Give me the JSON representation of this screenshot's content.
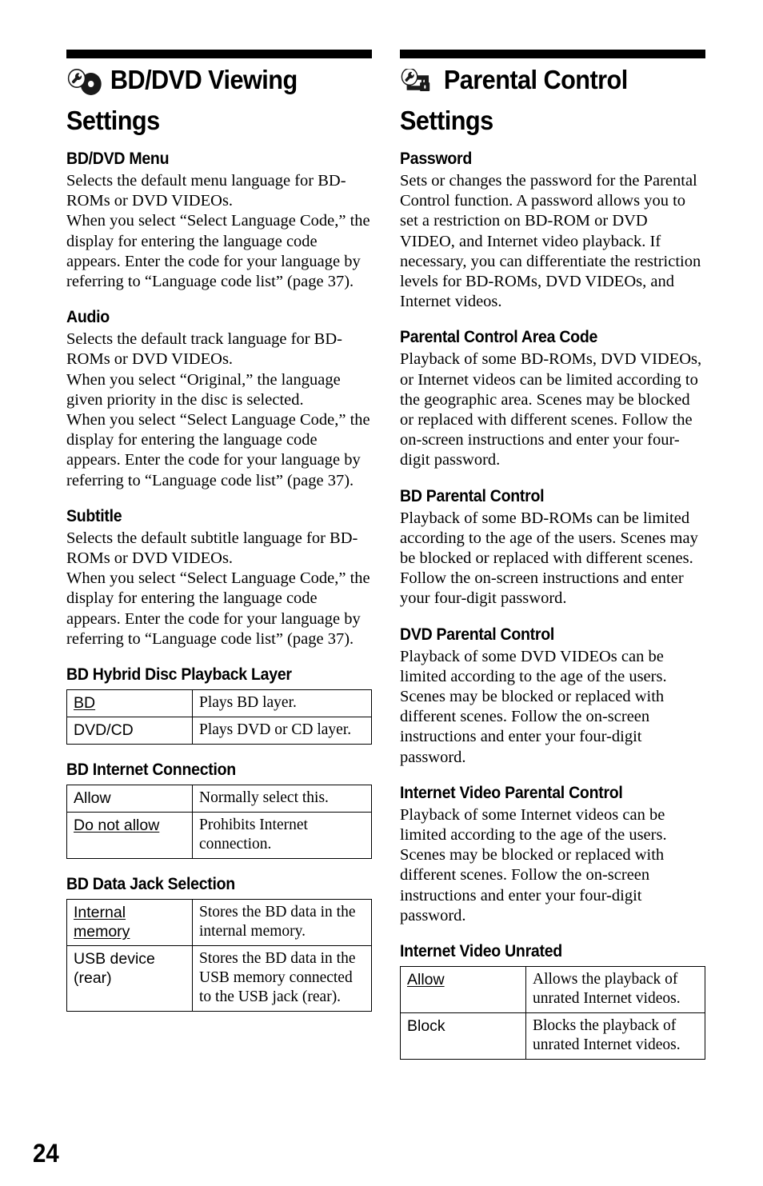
{
  "page": {
    "number": "24"
  },
  "left_column": {
    "title": "BD/DVD Viewing Settings",
    "icon": "wrench-disc-icon",
    "sections": [
      {
        "heading": "BD/DVD Menu",
        "body": "Selects the default menu language for BD-ROMs or DVD VIDEOs.\nWhen you select “Select Language Code,” the display for entering the language code appears. Enter the code for your language by referring to “Language code list” (page 37)."
      },
      {
        "heading": "Audio",
        "body": "Selects the default track language for BD-ROMs or DVD VIDEOs.\nWhen you select “Original,” the language given priority in the disc is selected.\nWhen you select “Select Language Code,” the display for entering the language code appears. Enter the code for your language by referring to “Language code list” (page 37)."
      },
      {
        "heading": "Subtitle",
        "body": "Selects the default subtitle language for BD-ROMs or DVD VIDEOs.\nWhen you select “Select Language Code,” the display for entering the language code appears. Enter the code for your language by referring to “Language code list” (page 37)."
      }
    ],
    "tables": [
      {
        "heading": "BD Hybrid Disc Playback Layer",
        "rows": [
          {
            "option": "BD",
            "default": true,
            "description": "Plays BD layer."
          },
          {
            "option": "DVD/CD",
            "default": false,
            "description": "Plays DVD or CD layer."
          }
        ]
      },
      {
        "heading": "BD Internet Connection",
        "rows": [
          {
            "option": "Allow",
            "default": false,
            "description": "Normally select this."
          },
          {
            "option": "Do not allow",
            "default": true,
            "description": "Prohibits Internet connection."
          }
        ]
      },
      {
        "heading": "BD Data Jack Selection",
        "rows": [
          {
            "option": "Internal memory",
            "default": true,
            "description": "Stores the BD data in the internal memory."
          },
          {
            "option": "USB device (rear)",
            "default": false,
            "description": "Stores the BD data in the USB memory connected to the USB jack (rear)."
          }
        ]
      }
    ]
  },
  "right_column": {
    "title": "Parental Control Settings",
    "icon": "wrench-screen-lock-icon",
    "sections": [
      {
        "heading": "Password",
        "body": "Sets or changes the password for the Parental Control function. A password allows you to set a restriction on BD-ROM or DVD VIDEO, and Internet video playback. If necessary, you can differentiate the restriction levels for BD-ROMs, DVD VIDEOs, and Internet videos."
      },
      {
        "heading": "Parental Control Area Code",
        "body": "Playback of some BD-ROMs, DVD VIDEOs, or Internet videos can be limited according to the geographic area. Scenes may be blocked or replaced with different scenes. Follow the on-screen instructions and enter your four-digit password."
      },
      {
        "heading": "BD Parental Control",
        "body": "Playback of some BD-ROMs can be limited according to the age of the users. Scenes may be blocked or replaced with different scenes. Follow the on-screen instructions and enter your four-digit password."
      },
      {
        "heading": "DVD Parental Control",
        "body": "Playback of some DVD VIDEOs can be limited according to the age of the users. Scenes may be blocked or replaced with different scenes. Follow the on-screen instructions and enter your four-digit password."
      },
      {
        "heading": "Internet Video Parental Control",
        "body": "Playback of some Internet videos can be limited according to the age of the users. Scenes may be blocked or replaced with different scenes. Follow the on-screen instructions and enter your four-digit password."
      }
    ],
    "tables": [
      {
        "heading": "Internet Video Unrated",
        "rows": [
          {
            "option": "Allow",
            "default": true,
            "description": "Allows the playback of unrated Internet videos."
          },
          {
            "option": "Block",
            "default": false,
            "description": "Blocks the playback of unrated Internet videos."
          }
        ]
      }
    ]
  }
}
